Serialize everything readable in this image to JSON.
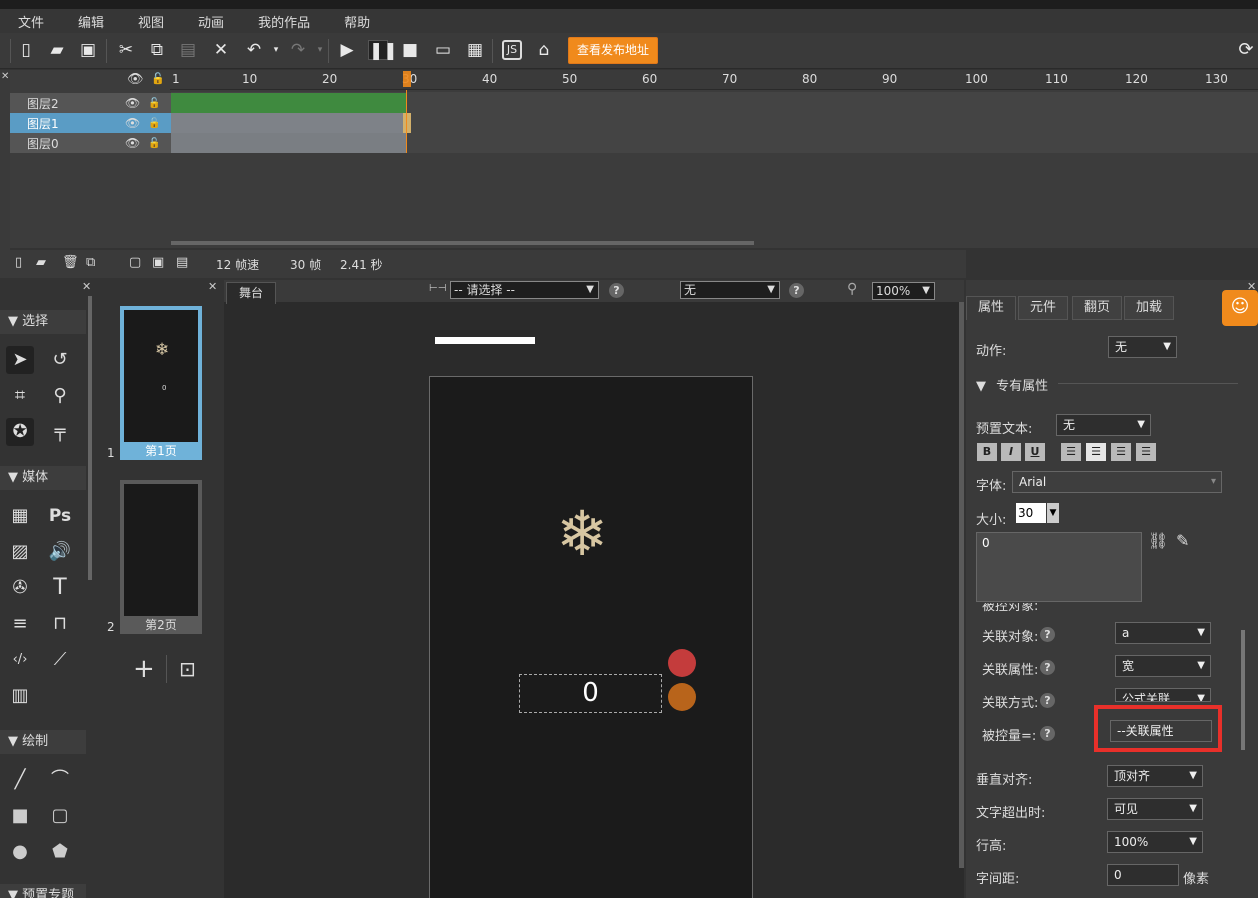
{
  "menu": [
    "文件",
    "编辑",
    "视图",
    "动画",
    "我的作品",
    "帮助"
  ],
  "toolbar": {
    "publish_label": "查看发布地址"
  },
  "timeline": {
    "ruler": [
      "1",
      "10",
      "20",
      "30",
      "40",
      "50",
      "60",
      "70",
      "80",
      "90",
      "100",
      "110",
      "120",
      "130"
    ],
    "layers": [
      "图层2",
      "图层1",
      "图层0"
    ],
    "fps": "12 帧速",
    "frames": "30 帧",
    "seconds": "2.41 秒"
  },
  "tools": {
    "select_head": "选择",
    "media_head": "媒体",
    "draw_head": "绘制",
    "preset_head": "预置专题"
  },
  "pages": [
    {
      "num": "1",
      "label": "第1页"
    },
    {
      "num": "2",
      "label": "第2页"
    }
  ],
  "stage": {
    "tab": "舞台",
    "select1": "-- 请选择 --",
    "select2": "无",
    "zoom": "100%",
    "counter": "0"
  },
  "props": {
    "tabs": [
      "属性",
      "元件",
      "翻页",
      "加载"
    ],
    "action_label": "动作:",
    "action_value": "无",
    "section": "专有属性",
    "preset_text_label": "预置文本:",
    "preset_text_value": "无",
    "font_label": "字体:",
    "font_value": "Arial",
    "size_label": "大小:",
    "size_value": "30",
    "text_content": "0",
    "clipped_label": "被控对象:",
    "bind_obj_label": "关联对象:",
    "bind_obj_value": "a",
    "bind_prop_label": "关联属性:",
    "bind_prop_value": "宽",
    "bind_mode_label": "关联方式:",
    "bind_mode_value": "公式关联",
    "controlled_label": "被控量=:",
    "controlled_value": "--关联属性",
    "valign_label": "垂直对齐:",
    "valign_value": "顶对齐",
    "overflow_label": "文字超出时:",
    "overflow_value": "可见",
    "lineheight_label": "行高:",
    "lineheight_value": "100%",
    "spacing_label": "字间距:",
    "spacing_value": "0",
    "spacing_unit": "像素"
  }
}
